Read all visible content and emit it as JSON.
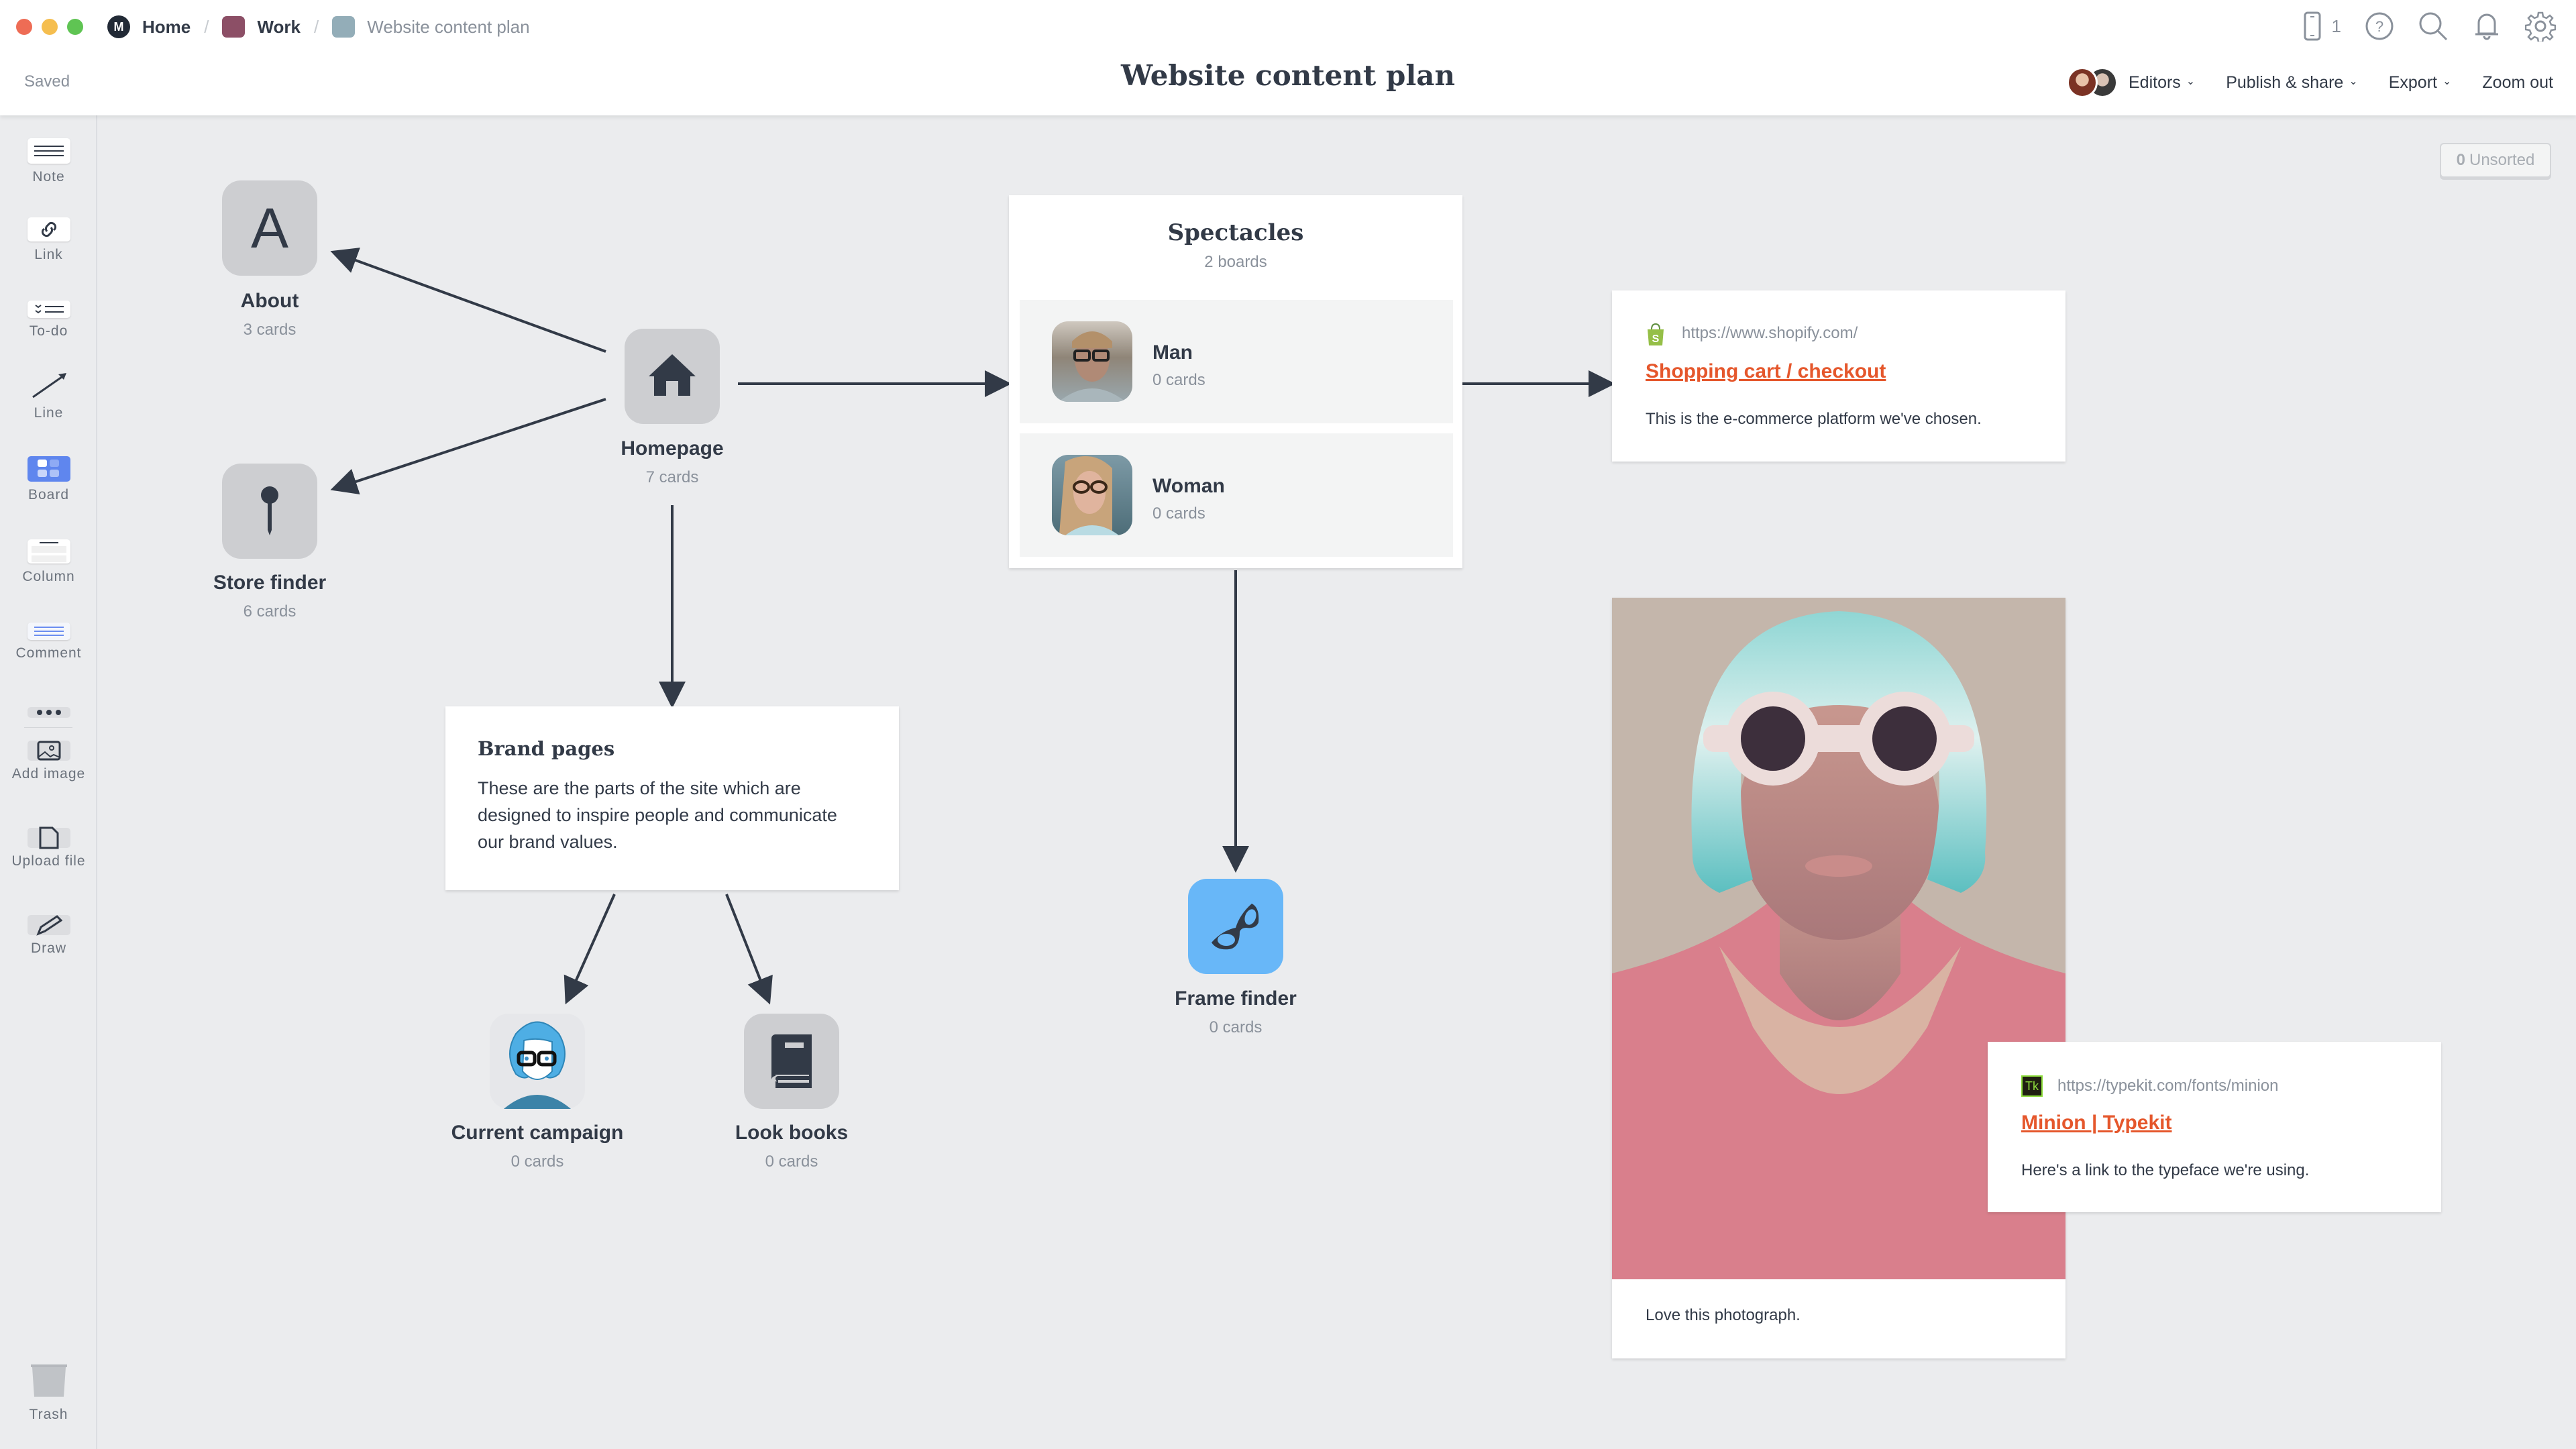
{
  "window": {
    "breadcrumbs": [
      {
        "label": "Home",
        "icon": "milanote-logo-icon"
      },
      {
        "label": "Work",
        "color": "#8c4f66"
      },
      {
        "label": "Website content plan",
        "color": "#93adb8"
      }
    ],
    "status": "Saved",
    "title": "Website content plan"
  },
  "top_icons": {
    "device_count": "1",
    "items": [
      "mobile-device-icon",
      "help-icon",
      "search-icon",
      "notification-bell-icon",
      "settings-gear-icon"
    ]
  },
  "menu": {
    "editors": "Editors",
    "publish": "Publish & share",
    "export": "Export",
    "zoom": "Zoom out"
  },
  "sidebar": {
    "tools": [
      {
        "label": "Note",
        "icon": "note-icon"
      },
      {
        "label": "Link",
        "icon": "link-icon"
      },
      {
        "label": "To-do",
        "icon": "todo-icon"
      },
      {
        "label": "Line",
        "icon": "line-arrow-icon"
      },
      {
        "label": "Board",
        "icon": "board-icon"
      },
      {
        "label": "Column",
        "icon": "column-icon"
      },
      {
        "label": "Comment",
        "icon": "comment-icon"
      },
      {
        "label": "",
        "icon": "more-icon"
      },
      {
        "label": "Add image",
        "icon": "image-icon"
      },
      {
        "label": "Upload file",
        "icon": "file-icon"
      },
      {
        "label": "Draw",
        "icon": "pencil-icon"
      }
    ],
    "trash": "Trash"
  },
  "unsorted": {
    "count": "0",
    "label": "Unsorted"
  },
  "boards": {
    "about": {
      "title": "About",
      "sub": "3 cards",
      "glyph": "A"
    },
    "store_finder": {
      "title": "Store finder",
      "sub": "6 cards"
    },
    "homepage": {
      "title": "Homepage",
      "sub": "7 cards"
    },
    "current_campaign": {
      "title": "Current campaign",
      "sub": "0 cards"
    },
    "look_books": {
      "title": "Look books",
      "sub": "0 cards"
    },
    "frame_finder": {
      "title": "Frame finder",
      "sub": "0 cards",
      "color": "#68b7f8"
    }
  },
  "spectacles": {
    "title": "Spectacles",
    "sub": "2 boards",
    "items": [
      {
        "name": "Man",
        "sub": "0 cards"
      },
      {
        "name": "Woman",
        "sub": "0 cards"
      }
    ]
  },
  "links": {
    "shopify": {
      "url": "https://www.shopify.com/",
      "title": "Shopping cart / checkout",
      "desc": "This is the e-commerce platform we've chosen."
    },
    "typekit": {
      "url": "https://typekit.com/fonts/minion",
      "title": "Minion | Typekit",
      "desc": "Here's a link to the typeface we're using.",
      "badge": "Tk"
    }
  },
  "brand_note": {
    "title": "Brand pages",
    "body": "These are the parts of the site which are designed to inspire people and communicate our brand values."
  },
  "image_card": {
    "caption": "Love this photograph."
  },
  "colors": {
    "accent_link": "#e5572c",
    "board_blue": "#5f86ee",
    "canvas": "#ebecee"
  }
}
